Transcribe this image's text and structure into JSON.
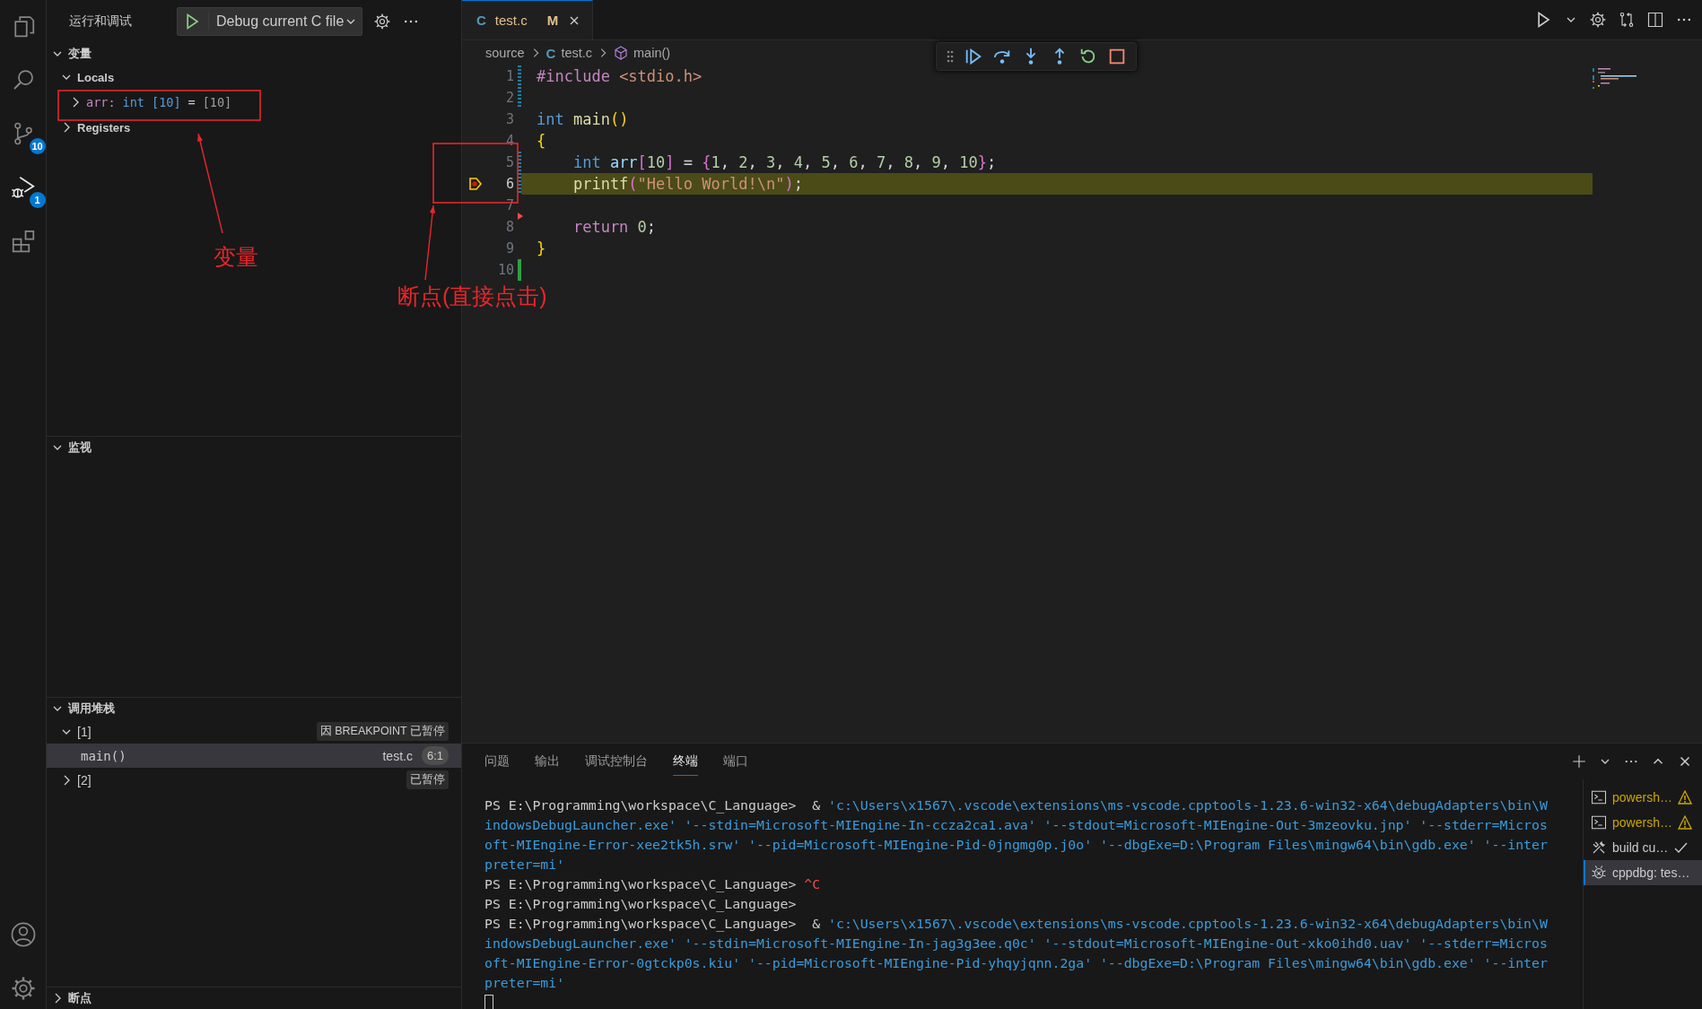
{
  "activity_bar": {
    "items": [
      {
        "kind": "files",
        "selected": false
      },
      {
        "kind": "search",
        "selected": false
      },
      {
        "kind": "source-control",
        "badge": "10",
        "selected": false
      },
      {
        "kind": "run-debug",
        "badge": "1",
        "selected": true
      },
      {
        "kind": "extensions",
        "selected": false
      }
    ],
    "bottom": [
      {
        "kind": "account"
      },
      {
        "kind": "settings"
      }
    ]
  },
  "sidebar": {
    "title": "运行和调试",
    "launch_config": "Debug current C file",
    "sections": [
      {
        "kind": "variables",
        "title": "变量",
        "expanded": true,
        "scopes": [
          {
            "name": "Locals",
            "expanded": true,
            "children": [
              {
                "expanded": false,
                "label": [
                  {
                    "kind": "name",
                    "text": "arr:"
                  },
                  {
                    "kind": "type",
                    "text": "int [10]"
                  },
                  {
                    "kind": "operator",
                    "text": "="
                  },
                  {
                    "kind": "value",
                    "text": "[10]"
                  }
                ]
              }
            ]
          },
          {
            "name": "Registers",
            "expanded": false
          }
        ]
      },
      {
        "kind": "watch",
        "title": "监视",
        "expanded": true
      },
      {
        "kind": "call_stack",
        "title": "调用堆栈",
        "expanded": true,
        "threads": [
          {
            "name": "[1]",
            "expanded": true,
            "status": "因 BREAKPOINT 已暂停",
            "frames": [
              {
                "name": "main()",
                "file": "test.c",
                "position": "6:1",
                "selected": true
              }
            ]
          },
          {
            "name": "[2]",
            "expanded": false,
            "status": "已暂停"
          }
        ]
      },
      {
        "kind": "breakpoints",
        "title": "断点",
        "expanded": false
      }
    ]
  },
  "editor": {
    "tabs": [
      {
        "file_icon": "C",
        "label": "test.c",
        "modified_mark": "M",
        "selected": true
      }
    ],
    "actions": [
      {
        "kind": "run"
      },
      {
        "kind": "settings"
      },
      {
        "kind": "compare"
      },
      {
        "kind": "split"
      },
      {
        "kind": "more"
      }
    ],
    "breadcrumbs": [
      {
        "kind": "folder",
        "text": "source"
      },
      {
        "kind": "file",
        "file_icon": "C",
        "text": "test.c"
      },
      {
        "kind": "function",
        "text": "main()"
      }
    ],
    "debug_toolbar": [
      {
        "kind": "gripper"
      },
      {
        "kind": "continue"
      },
      {
        "kind": "step-over"
      },
      {
        "kind": "step-into"
      },
      {
        "kind": "step-out"
      },
      {
        "kind": "restart"
      },
      {
        "kind": "stop"
      }
    ],
    "lines": [
      {
        "number": "1",
        "kind": "modified",
        "current": false,
        "breakpoint": false,
        "tokens": [
          {
            "kind": "pp",
            "text": "#include"
          },
          {
            "kind": "inc",
            "text": " <stdio.h>"
          }
        ]
      },
      {
        "number": "2",
        "kind": "modified",
        "current": false,
        "breakpoint": false
      },
      {
        "number": "3",
        "kind": "plain",
        "current": false,
        "breakpoint": false,
        "tokens": [
          {
            "kind": "kw",
            "text": "int"
          },
          {
            "kind": "fn",
            "text": " main"
          },
          {
            "kind": "br1",
            "text": "()"
          }
        ]
      },
      {
        "number": "4",
        "kind": "plain",
        "current": false,
        "breakpoint": false,
        "tokens": [
          {
            "kind": "br1",
            "text": "{"
          }
        ]
      },
      {
        "number": "5",
        "kind": "modified",
        "current": false,
        "breakpoint": false,
        "tokens": [
          {
            "kind": "kw",
            "text": "    int"
          },
          {
            "kind": "var",
            "text": " arr"
          },
          {
            "kind": "br2",
            "text": "["
          },
          {
            "kind": "num",
            "text": "10"
          },
          {
            "kind": "br2",
            "text": "]"
          },
          {
            "kind": "op",
            "text": " = "
          },
          {
            "kind": "br2",
            "text": "{"
          },
          {
            "kind": "num",
            "text": "1"
          },
          {
            "kind": "op",
            "text": ", "
          },
          {
            "kind": "num",
            "text": "2"
          },
          {
            "kind": "op",
            "text": ", "
          },
          {
            "kind": "num",
            "text": "3"
          },
          {
            "kind": "op",
            "text": ", "
          },
          {
            "kind": "num",
            "text": "4"
          },
          {
            "kind": "op",
            "text": ", "
          },
          {
            "kind": "num",
            "text": "5"
          },
          {
            "kind": "op",
            "text": ", "
          },
          {
            "kind": "num",
            "text": "6"
          },
          {
            "kind": "op",
            "text": ", "
          },
          {
            "kind": "num",
            "text": "7"
          },
          {
            "kind": "op",
            "text": ", "
          },
          {
            "kind": "num",
            "text": "8"
          },
          {
            "kind": "op",
            "text": ", "
          },
          {
            "kind": "num",
            "text": "9"
          },
          {
            "kind": "op",
            "text": ", "
          },
          {
            "kind": "num",
            "text": "10"
          },
          {
            "kind": "br2",
            "text": "}"
          },
          {
            "kind": "op",
            "text": ";"
          }
        ]
      },
      {
        "number": "6",
        "kind": "modified",
        "current": true,
        "breakpoint": true,
        "tokens": [
          {
            "kind": "fn",
            "text": "    printf"
          },
          {
            "kind": "br2",
            "text": "("
          },
          {
            "kind": "str",
            "text": "\"Hello World!\\n\""
          },
          {
            "kind": "br2",
            "text": ")"
          },
          {
            "kind": "op",
            "text": ";"
          }
        ]
      },
      {
        "number": "7",
        "kind": "deleted",
        "current": false,
        "breakpoint": false
      },
      {
        "number": "8",
        "kind": "plain",
        "current": false,
        "breakpoint": false,
        "tokens": [
          {
            "kind": "ctl",
            "text": "    return"
          },
          {
            "kind": "num",
            "text": " 0"
          },
          {
            "kind": "op",
            "text": ";"
          }
        ]
      },
      {
        "number": "9",
        "kind": "plain",
        "current": false,
        "breakpoint": false,
        "tokens": [
          {
            "kind": "br1",
            "text": "}"
          }
        ]
      },
      {
        "number": "10",
        "kind": "added",
        "current": false,
        "breakpoint": false
      }
    ]
  },
  "panel": {
    "tabs": [
      {
        "label": "问题",
        "selected": false
      },
      {
        "label": "输出",
        "selected": false
      },
      {
        "label": "调试控制台",
        "selected": false
      },
      {
        "label": "终端",
        "selected": true
      },
      {
        "label": "端口",
        "selected": false
      }
    ],
    "actions": [
      {
        "kind": "add"
      },
      {
        "kind": "more"
      },
      {
        "kind": "maximize"
      },
      {
        "kind": "close"
      }
    ],
    "terminal": [
      [
        {
          "kind": "text",
          "text": "PS E:\\Programming\\workspace\\C_Language>  & "
        },
        {
          "kind": "string",
          "text": "'c:\\Users\\x1567\\.vscode\\extensions\\ms-vscode.cpptools-1.23.6-win32-x64\\debugAdapters\\bin\\W"
        }
      ],
      [
        {
          "kind": "string",
          "text": "indowsDebugLauncher.exe' '--stdin=Microsoft-MIEngine-In-ccza2ca1.ava' '--stdout=Microsoft-MIEngine-Out-3mzeovku.jnp' '--stderr=Micros"
        }
      ],
      [
        {
          "kind": "string",
          "text": "oft-MIEngine-Error-xee2tk5h.srw' '--pid=Microsoft-MIEngine-Pid-0jngmg0p.j0o' '--dbgExe=D:\\Program Files\\mingw64\\bin\\gdb.exe' '--inter"
        }
      ],
      [
        {
          "kind": "string",
          "text": "preter=mi'"
        }
      ],
      [
        {
          "kind": "text",
          "text": "PS E:\\Programming\\workspace\\C_Language> "
        },
        {
          "kind": "error",
          "text": "^C"
        }
      ],
      [
        {
          "kind": "text",
          "text": "PS E:\\Programming\\workspace\\C_Language>"
        }
      ],
      [
        {
          "kind": "text",
          "text": "PS E:\\Programming\\workspace\\C_Language>  & "
        },
        {
          "kind": "string",
          "text": "'c:\\Users\\x1567\\.vscode\\extensions\\ms-vscode.cpptools-1.23.6-win32-x64\\debugAdapters\\bin\\W"
        }
      ],
      [
        {
          "kind": "string",
          "text": "indowsDebugLauncher.exe' '--stdin=Microsoft-MIEngine-In-jag3g3ee.q0c' '--stdout=Microsoft-MIEngine-Out-xko0ihd0.uav' '--stderr=Micros"
        }
      ],
      [
        {
          "kind": "string",
          "text": "oft-MIEngine-Error-0gtckp0s.kiu' '--pid=Microsoft-MIEngine-Pid-yhqyjqnn.2ga' '--dbgExe=D:\\Program Files\\mingw64\\bin\\gdb.exe' '--inter"
        }
      ],
      [
        {
          "kind": "string",
          "text": "preter=mi'"
        }
      ]
    ],
    "terminal_list": [
      {
        "kind": "terminal",
        "label": "powersh…",
        "warning": true,
        "succeeded": false,
        "selected": false
      },
      {
        "kind": "terminal",
        "label": "powersh…",
        "warning": true,
        "succeeded": false,
        "selected": false
      },
      {
        "kind": "tools",
        "label": "build cu…",
        "warning": false,
        "succeeded": true,
        "selected": false
      },
      {
        "kind": "debug",
        "label": "cppdbg: tes…",
        "warning": false,
        "succeeded": false,
        "selected": true
      }
    ]
  },
  "annotations": [
    {
      "kind": "variables-note",
      "text": "变量"
    },
    {
      "kind": "breakpoint-note",
      "text": "断点(直接点击)"
    }
  ]
}
